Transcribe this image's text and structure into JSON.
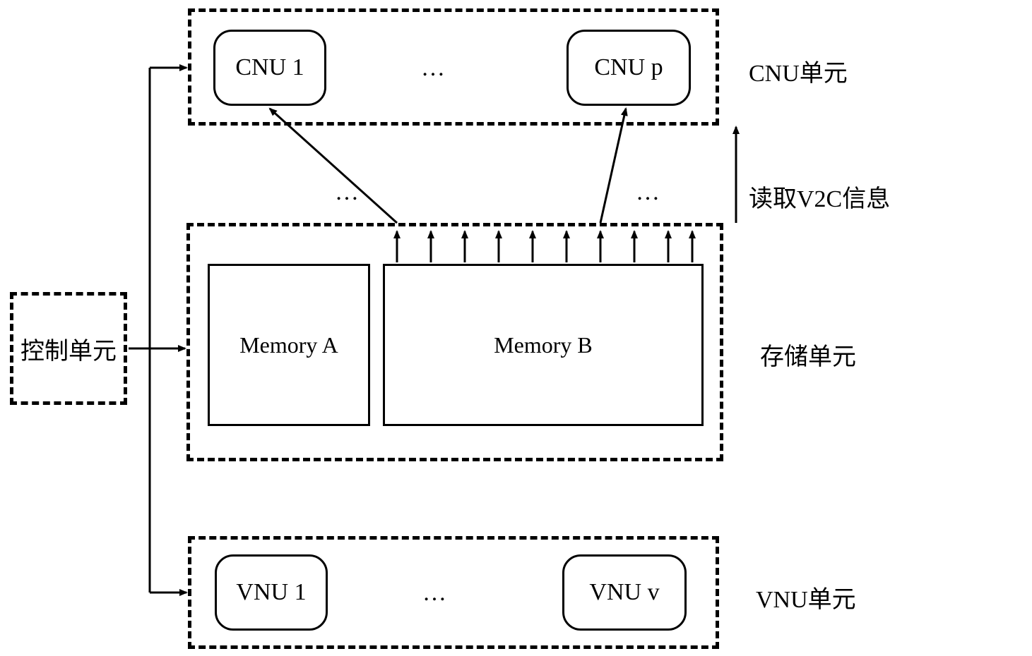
{
  "control_unit": {
    "label": "控制单元"
  },
  "cnu_unit": {
    "label": "CNU单元",
    "cnu1": "CNU 1",
    "cnup": "CNU  p",
    "ellipsis": "…"
  },
  "read_v2c": "读取V2C信息",
  "storage_unit": {
    "label": "存储单元",
    "ellipsis_left": "…",
    "ellipsis_right": "…",
    "memory_a": "Memory A",
    "memory_b": "Memory B"
  },
  "vnu_unit": {
    "label": "VNU单元",
    "vnu1": "VNU 1",
    "vnuv": "VNU  v",
    "ellipsis": "…"
  }
}
